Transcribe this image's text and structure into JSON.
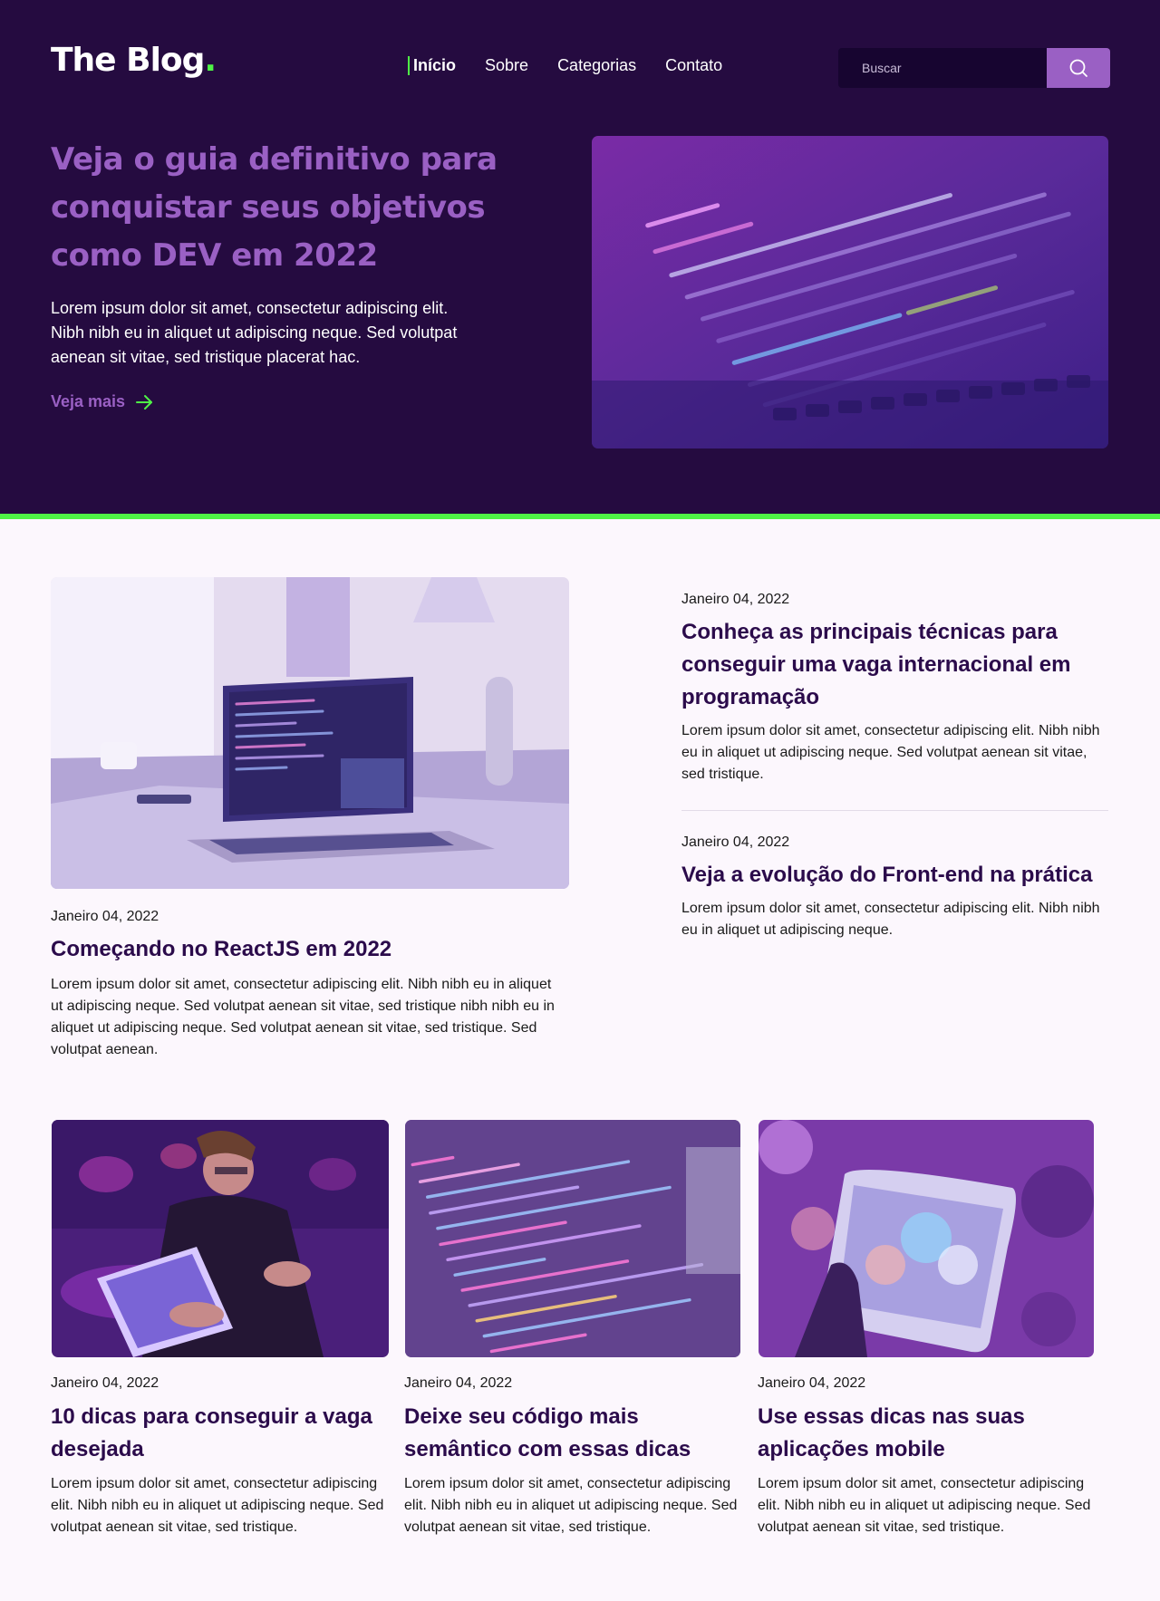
{
  "brand": {
    "name": "The Blog",
    "dot": ".",
    "accent": "#4ff346",
    "primary": "#9a60c4",
    "dark": "#250b40"
  },
  "nav": {
    "items": [
      {
        "label": "Início",
        "active": true
      },
      {
        "label": "Sobre"
      },
      {
        "label": "Categorias"
      },
      {
        "label": "Contato"
      }
    ]
  },
  "search": {
    "placeholder": "Buscar",
    "icon": "search-icon"
  },
  "hero": {
    "title": "Veja o guia definitivo para conquistar seus objetivos como DEV em 2022",
    "text": "Lorem ipsum dolor sit amet, consectetur adipiscing elit. Nibh nibh eu in aliquet ut adipiscing neque. Sed volutpat aenean sit vitae, sed tristique placerat hac.",
    "link_label": "Veja mais",
    "link_icon": "arrow-right-icon"
  },
  "featured": {
    "date": "Janeiro 04, 2022",
    "title": "Começando no ReactJS em 2022",
    "excerpt": "Lorem ipsum dolor sit amet, consectetur adipiscing elit. Nibh nibh eu in aliquet ut adipiscing neque. Sed volutpat aenean sit vitae, sed tristique nibh nibh eu in aliquet ut adipiscing neque. Sed volutpat aenean sit vitae, sed tristique. Sed volutpat aenean."
  },
  "side_posts": [
    {
      "date": "Janeiro 04, 2022",
      "title": "Conheça as principais técnicas para conseguir uma vaga internacional em programação",
      "excerpt": "Lorem ipsum dolor sit amet, consectetur adipiscing elit. Nibh nibh eu in aliquet ut adipiscing neque. Sed volutpat aenean sit vitae, sed tristique."
    },
    {
      "date": "Janeiro 04, 2022",
      "title": "Veja a evolução do Front-end na prática",
      "excerpt": "Lorem ipsum dolor sit amet, consectetur adipiscing elit. Nibh nibh eu in aliquet ut adipiscing neque."
    }
  ],
  "grid_posts": [
    {
      "date": "Janeiro 04, 2022",
      "title": "10 dicas para conseguir a vaga desejada",
      "excerpt": "Lorem ipsum dolor sit amet, consectetur adipiscing elit. Nibh nibh eu in aliquet ut adipiscing neque. Sed volutpat aenean sit vitae, sed tristique."
    },
    {
      "date": "Janeiro 04, 2022",
      "title": "Deixe seu código mais semântico com essas dicas",
      "excerpt": "Lorem ipsum dolor sit amet, consectetur adipiscing elit. Nibh nibh eu in aliquet ut adipiscing neque. Sed volutpat aenean sit vitae, sed tristique."
    },
    {
      "date": "Janeiro 04, 2022",
      "title": "Use essas dicas nas suas aplicações mobile",
      "excerpt": "Lorem ipsum dolor sit amet, consectetur adipiscing elit. Nibh nibh eu in aliquet ut adipiscing neque. Sed volutpat aenean sit vitae, sed tristique."
    }
  ]
}
